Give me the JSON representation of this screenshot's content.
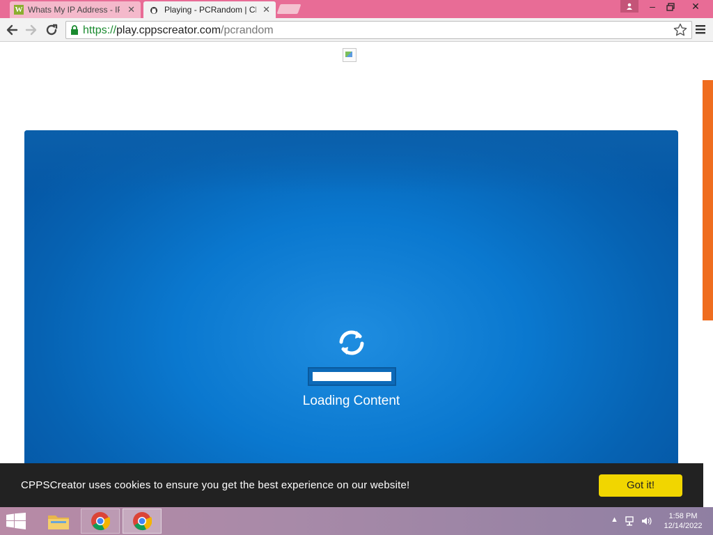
{
  "browser": {
    "tabs": [
      {
        "title": "Whats My IP Address - IP",
        "favicon": "W"
      },
      {
        "title": "Playing - PCRandom | CPP"
      }
    ],
    "url": {
      "scheme": "https://",
      "host": "play.cppscreator.com",
      "path": "/pcrandom"
    }
  },
  "page": {
    "loading_text": "Loading Content",
    "progress": 1.0,
    "cookie_message": "CPPSCreator uses cookies to ensure you get the best experience on our website!",
    "cookie_button": "Got it!"
  },
  "taskbar": {
    "time": "1:58 PM",
    "date": "12/14/2022"
  },
  "colors": {
    "titlebar": "#e86c96",
    "game_blue": "#0a78cf",
    "cookie_button": "#f1d600",
    "side_accent": "#ef6d1f"
  }
}
